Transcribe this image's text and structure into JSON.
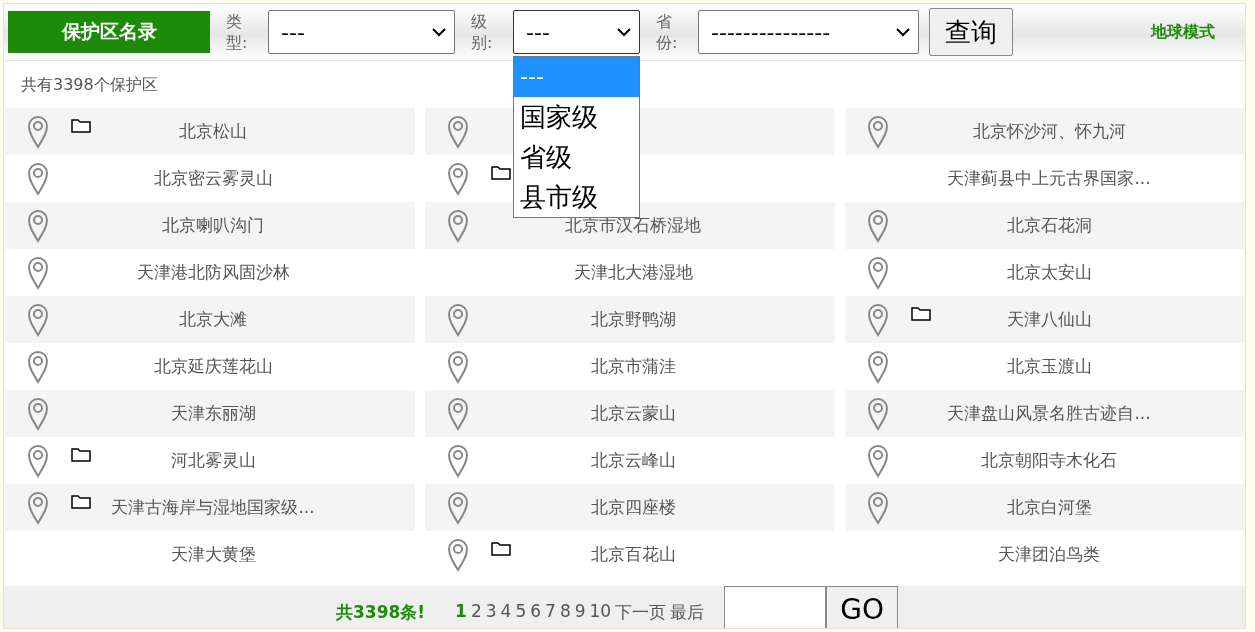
{
  "header": {
    "title": "保护区名录",
    "filters": [
      {
        "label": "类型:",
        "value": "---",
        "open": false
      },
      {
        "label": "级别:",
        "value": "---",
        "open": true,
        "options": [
          {
            "label": "---",
            "selected": true
          },
          {
            "label": "国家级",
            "selected": false
          },
          {
            "label": "省级",
            "selected": false
          },
          {
            "label": "县市级",
            "selected": false
          }
        ]
      },
      {
        "label": "省份:",
        "value": "---------------",
        "open": false
      }
    ],
    "search_button": "查询",
    "mode_link": "地球模式"
  },
  "summary": "共有3398个保护区",
  "reserves": [
    {
      "pin": true,
      "folder": true,
      "name": "北京松山"
    },
    {
      "pin": true,
      "folder": false
    },
    {
      "pin": true,
      "folder": false,
      "name": "北京怀沙河、怀九河"
    },
    {
      "pin": true,
      "folder": false,
      "name": "北京密云雾灵山"
    },
    {
      "pin": true,
      "folder": true
    },
    {
      "pin": false,
      "folder": false,
      "name": "天津蓟县中上元古界国家..."
    },
    {
      "pin": true,
      "folder": false,
      "name": "北京喇叭沟门"
    },
    {
      "pin": true,
      "folder": false,
      "name": "北京市汉石桥湿地"
    },
    {
      "pin": true,
      "folder": false,
      "name": "北京石花洞"
    },
    {
      "pin": true,
      "folder": false,
      "name": "天津港北防风固沙林"
    },
    {
      "pin": false,
      "folder": false,
      "name": "天津北大港湿地"
    },
    {
      "pin": true,
      "folder": false,
      "name": "北京太安山"
    },
    {
      "pin": true,
      "folder": false,
      "name": "北京大滩"
    },
    {
      "pin": true,
      "folder": false,
      "name": "北京野鸭湖"
    },
    {
      "pin": true,
      "folder": true,
      "name": "天津八仙山"
    },
    {
      "pin": true,
      "folder": false,
      "name": "北京延庆莲花山"
    },
    {
      "pin": true,
      "folder": false,
      "name": "北京市蒲洼"
    },
    {
      "pin": true,
      "folder": false,
      "name": "北京玉渡山"
    },
    {
      "pin": true,
      "folder": false,
      "name": "天津东丽湖"
    },
    {
      "pin": true,
      "folder": false,
      "name": "北京云蒙山"
    },
    {
      "pin": true,
      "folder": false,
      "name": "天津盘山风景名胜古迹自..."
    },
    {
      "pin": true,
      "folder": true,
      "name": "河北雾灵山"
    },
    {
      "pin": true,
      "folder": false,
      "name": "北京云峰山"
    },
    {
      "pin": true,
      "folder": false,
      "name": "北京朝阳寺木化石"
    },
    {
      "pin": true,
      "folder": true,
      "name": "天津古海岸与湿地国家级..."
    },
    {
      "pin": true,
      "folder": false,
      "name": "北京四座楼"
    },
    {
      "pin": true,
      "folder": false,
      "name": "北京白河堡"
    },
    {
      "pin": false,
      "folder": false,
      "name": "天津大黄堡"
    },
    {
      "pin": true,
      "folder": true,
      "name": "北京百花山"
    },
    {
      "pin": false,
      "folder": false,
      "name": "天津团泊鸟类"
    }
  ],
  "pager": {
    "total": "共3398条!",
    "pages": [
      {
        "label": "1",
        "selected": true
      },
      {
        "label": "2",
        "selected": false
      },
      {
        "label": "3",
        "selected": false
      },
      {
        "label": "4",
        "selected": false
      },
      {
        "label": "5",
        "selected": false
      },
      {
        "label": "6",
        "selected": false
      },
      {
        "label": "7",
        "selected": false
      },
      {
        "label": "8",
        "selected": false
      },
      {
        "label": "9",
        "selected": false
      },
      {
        "label": "10",
        "selected": false
      }
    ],
    "next": "下一页",
    "last": "最后",
    "go_button": "GO"
  }
}
